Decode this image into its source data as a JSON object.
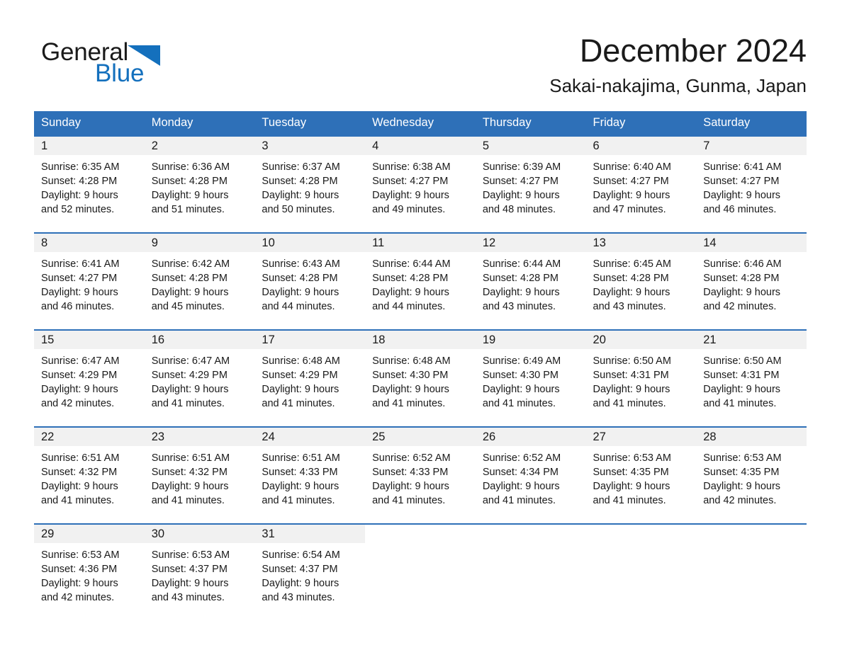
{
  "logo": {
    "word_top": "General",
    "word_bottom": "Blue",
    "triangle_icon": "triangle-icon",
    "color_black": "#1a1a1a",
    "color_blue": "#1470bd"
  },
  "header": {
    "title": "December 2024",
    "subtitle": "Sakai-nakajima, Gunma, Japan"
  },
  "theme": {
    "header_blue": "#2e70b8",
    "row_divider_blue": "#2e70b8",
    "daynum_band_gray": "#f1f1f1",
    "text_black": "#1a1a1a",
    "page_background": "#ffffff"
  },
  "calendar": {
    "weekday_headers": [
      "Sunday",
      "Monday",
      "Tuesday",
      "Wednesday",
      "Thursday",
      "Friday",
      "Saturday"
    ],
    "weeks": [
      [
        {
          "day": "1",
          "sunrise": "Sunrise: 6:35 AM",
          "sunset": "Sunset: 4:28 PM",
          "daylight_line1": "Daylight: 9 hours",
          "daylight_line2": "and 52 minutes."
        },
        {
          "day": "2",
          "sunrise": "Sunrise: 6:36 AM",
          "sunset": "Sunset: 4:28 PM",
          "daylight_line1": "Daylight: 9 hours",
          "daylight_line2": "and 51 minutes."
        },
        {
          "day": "3",
          "sunrise": "Sunrise: 6:37 AM",
          "sunset": "Sunset: 4:28 PM",
          "daylight_line1": "Daylight: 9 hours",
          "daylight_line2": "and 50 minutes."
        },
        {
          "day": "4",
          "sunrise": "Sunrise: 6:38 AM",
          "sunset": "Sunset: 4:27 PM",
          "daylight_line1": "Daylight: 9 hours",
          "daylight_line2": "and 49 minutes."
        },
        {
          "day": "5",
          "sunrise": "Sunrise: 6:39 AM",
          "sunset": "Sunset: 4:27 PM",
          "daylight_line1": "Daylight: 9 hours",
          "daylight_line2": "and 48 minutes."
        },
        {
          "day": "6",
          "sunrise": "Sunrise: 6:40 AM",
          "sunset": "Sunset: 4:27 PM",
          "daylight_line1": "Daylight: 9 hours",
          "daylight_line2": "and 47 minutes."
        },
        {
          "day": "7",
          "sunrise": "Sunrise: 6:41 AM",
          "sunset": "Sunset: 4:27 PM",
          "daylight_line1": "Daylight: 9 hours",
          "daylight_line2": "and 46 minutes."
        }
      ],
      [
        {
          "day": "8",
          "sunrise": "Sunrise: 6:41 AM",
          "sunset": "Sunset: 4:27 PM",
          "daylight_line1": "Daylight: 9 hours",
          "daylight_line2": "and 46 minutes."
        },
        {
          "day": "9",
          "sunrise": "Sunrise: 6:42 AM",
          "sunset": "Sunset: 4:28 PM",
          "daylight_line1": "Daylight: 9 hours",
          "daylight_line2": "and 45 minutes."
        },
        {
          "day": "10",
          "sunrise": "Sunrise: 6:43 AM",
          "sunset": "Sunset: 4:28 PM",
          "daylight_line1": "Daylight: 9 hours",
          "daylight_line2": "and 44 minutes."
        },
        {
          "day": "11",
          "sunrise": "Sunrise: 6:44 AM",
          "sunset": "Sunset: 4:28 PM",
          "daylight_line1": "Daylight: 9 hours",
          "daylight_line2": "and 44 minutes."
        },
        {
          "day": "12",
          "sunrise": "Sunrise: 6:44 AM",
          "sunset": "Sunset: 4:28 PM",
          "daylight_line1": "Daylight: 9 hours",
          "daylight_line2": "and 43 minutes."
        },
        {
          "day": "13",
          "sunrise": "Sunrise: 6:45 AM",
          "sunset": "Sunset: 4:28 PM",
          "daylight_line1": "Daylight: 9 hours",
          "daylight_line2": "and 43 minutes."
        },
        {
          "day": "14",
          "sunrise": "Sunrise: 6:46 AM",
          "sunset": "Sunset: 4:28 PM",
          "daylight_line1": "Daylight: 9 hours",
          "daylight_line2": "and 42 minutes."
        }
      ],
      [
        {
          "day": "15",
          "sunrise": "Sunrise: 6:47 AM",
          "sunset": "Sunset: 4:29 PM",
          "daylight_line1": "Daylight: 9 hours",
          "daylight_line2": "and 42 minutes."
        },
        {
          "day": "16",
          "sunrise": "Sunrise: 6:47 AM",
          "sunset": "Sunset: 4:29 PM",
          "daylight_line1": "Daylight: 9 hours",
          "daylight_line2": "and 41 minutes."
        },
        {
          "day": "17",
          "sunrise": "Sunrise: 6:48 AM",
          "sunset": "Sunset: 4:29 PM",
          "daylight_line1": "Daylight: 9 hours",
          "daylight_line2": "and 41 minutes."
        },
        {
          "day": "18",
          "sunrise": "Sunrise: 6:48 AM",
          "sunset": "Sunset: 4:30 PM",
          "daylight_line1": "Daylight: 9 hours",
          "daylight_line2": "and 41 minutes."
        },
        {
          "day": "19",
          "sunrise": "Sunrise: 6:49 AM",
          "sunset": "Sunset: 4:30 PM",
          "daylight_line1": "Daylight: 9 hours",
          "daylight_line2": "and 41 minutes."
        },
        {
          "day": "20",
          "sunrise": "Sunrise: 6:50 AM",
          "sunset": "Sunset: 4:31 PM",
          "daylight_line1": "Daylight: 9 hours",
          "daylight_line2": "and 41 minutes."
        },
        {
          "day": "21",
          "sunrise": "Sunrise: 6:50 AM",
          "sunset": "Sunset: 4:31 PM",
          "daylight_line1": "Daylight: 9 hours",
          "daylight_line2": "and 41 minutes."
        }
      ],
      [
        {
          "day": "22",
          "sunrise": "Sunrise: 6:51 AM",
          "sunset": "Sunset: 4:32 PM",
          "daylight_line1": "Daylight: 9 hours",
          "daylight_line2": "and 41 minutes."
        },
        {
          "day": "23",
          "sunrise": "Sunrise: 6:51 AM",
          "sunset": "Sunset: 4:32 PM",
          "daylight_line1": "Daylight: 9 hours",
          "daylight_line2": "and 41 minutes."
        },
        {
          "day": "24",
          "sunrise": "Sunrise: 6:51 AM",
          "sunset": "Sunset: 4:33 PM",
          "daylight_line1": "Daylight: 9 hours",
          "daylight_line2": "and 41 minutes."
        },
        {
          "day": "25",
          "sunrise": "Sunrise: 6:52 AM",
          "sunset": "Sunset: 4:33 PM",
          "daylight_line1": "Daylight: 9 hours",
          "daylight_line2": "and 41 minutes."
        },
        {
          "day": "26",
          "sunrise": "Sunrise: 6:52 AM",
          "sunset": "Sunset: 4:34 PM",
          "daylight_line1": "Daylight: 9 hours",
          "daylight_line2": "and 41 minutes."
        },
        {
          "day": "27",
          "sunrise": "Sunrise: 6:53 AM",
          "sunset": "Sunset: 4:35 PM",
          "daylight_line1": "Daylight: 9 hours",
          "daylight_line2": "and 41 minutes."
        },
        {
          "day": "28",
          "sunrise": "Sunrise: 6:53 AM",
          "sunset": "Sunset: 4:35 PM",
          "daylight_line1": "Daylight: 9 hours",
          "daylight_line2": "and 42 minutes."
        }
      ],
      [
        {
          "day": "29",
          "sunrise": "Sunrise: 6:53 AM",
          "sunset": "Sunset: 4:36 PM",
          "daylight_line1": "Daylight: 9 hours",
          "daylight_line2": "and 42 minutes."
        },
        {
          "day": "30",
          "sunrise": "Sunrise: 6:53 AM",
          "sunset": "Sunset: 4:37 PM",
          "daylight_line1": "Daylight: 9 hours",
          "daylight_line2": "and 43 minutes."
        },
        {
          "day": "31",
          "sunrise": "Sunrise: 6:54 AM",
          "sunset": "Sunset: 4:37 PM",
          "daylight_line1": "Daylight: 9 hours",
          "daylight_line2": "and 43 minutes."
        },
        {
          "day": "",
          "sunrise": "",
          "sunset": "",
          "daylight_line1": "",
          "daylight_line2": ""
        },
        {
          "day": "",
          "sunrise": "",
          "sunset": "",
          "daylight_line1": "",
          "daylight_line2": ""
        },
        {
          "day": "",
          "sunrise": "",
          "sunset": "",
          "daylight_line1": "",
          "daylight_line2": ""
        },
        {
          "day": "",
          "sunrise": "",
          "sunset": "",
          "daylight_line1": "",
          "daylight_line2": ""
        }
      ]
    ]
  }
}
